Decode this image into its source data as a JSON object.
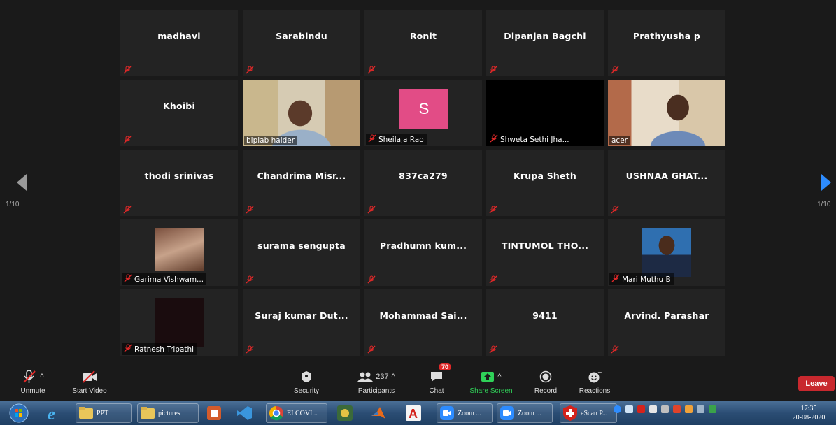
{
  "pager": {
    "left": "1/10",
    "right": "1/10"
  },
  "participants": [
    {
      "name": "madhavi",
      "type": "name"
    },
    {
      "name": "Sarabindu",
      "type": "name"
    },
    {
      "name": "Ronit",
      "type": "name"
    },
    {
      "name": "Dipanjan Bagchi",
      "type": "name"
    },
    {
      "name": "Prathyusha p",
      "type": "name"
    },
    {
      "name": "Khoibi",
      "type": "name"
    },
    {
      "name": "biplab halder",
      "type": "video",
      "active": true
    },
    {
      "name": "Sheilaja Rao",
      "type": "avatar",
      "initial": "S",
      "avatar_color": "#e24c86"
    },
    {
      "name": "Shweta Sethi Jha...",
      "type": "black"
    },
    {
      "name": "acer",
      "type": "video"
    },
    {
      "name": "thodi srinivas",
      "type": "name"
    },
    {
      "name": "Chandrima  Misr...",
      "type": "name"
    },
    {
      "name": "837ca279",
      "type": "name"
    },
    {
      "name": "Krupa Sheth",
      "type": "name"
    },
    {
      "name": "USHNAA  GHAT...",
      "type": "name"
    },
    {
      "name": "Garima Vishwam...",
      "type": "photo"
    },
    {
      "name": "surama sengupta",
      "type": "name"
    },
    {
      "name": "Pradhumn  kum...",
      "type": "name"
    },
    {
      "name": "TINTUMOL  THO...",
      "type": "name"
    },
    {
      "name": "Mari Muthu B",
      "type": "photo"
    },
    {
      "name": "Ratnesh Tripathi",
      "type": "photo"
    },
    {
      "name": "Suraj kumar Dut...",
      "type": "name"
    },
    {
      "name": "Mohammad  Sai...",
      "type": "name"
    },
    {
      "name": "9411",
      "type": "name"
    },
    {
      "name": "Arvind. Parashar",
      "type": "name"
    }
  ],
  "toolbar": {
    "unmute": "Unmute",
    "start_video": "Start Video",
    "security": "Security",
    "participants": "Participants",
    "participants_count": "237",
    "chat": "Chat",
    "chat_badge": "70",
    "share_screen": "Share Screen",
    "record": "Record",
    "reactions": "Reactions",
    "leave": "Leave"
  },
  "taskbar": {
    "ppt": "PPT",
    "pictures": "pictures",
    "chrome": "EI COVI...",
    "zoom1": "Zoom ...",
    "zoom2": "Zoom ...",
    "escan": "eScan P...",
    "time": "17:35",
    "date": "20-08-2020"
  },
  "colors": {
    "share_green": "#2fd158",
    "leave_red": "#c8282e",
    "active_border": "#cde86a",
    "muted_red": "#e02828"
  }
}
